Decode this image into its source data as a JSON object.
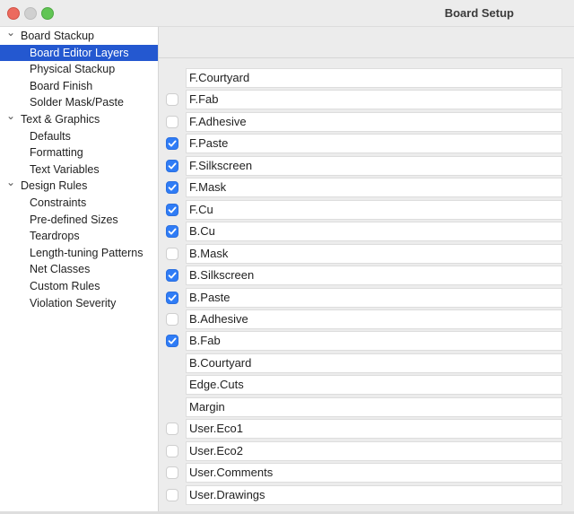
{
  "window": {
    "title": "Board Setup"
  },
  "sidebar": {
    "items": [
      {
        "label": "Board Stackup",
        "level": 0,
        "expanded": true,
        "selected": false
      },
      {
        "label": "Board Editor Layers",
        "level": 1,
        "selected": true
      },
      {
        "label": "Physical Stackup",
        "level": 1,
        "selected": false
      },
      {
        "label": "Board Finish",
        "level": 1,
        "selected": false
      },
      {
        "label": "Solder Mask/Paste",
        "level": 1,
        "selected": false
      },
      {
        "label": "Text & Graphics",
        "level": 0,
        "expanded": true,
        "selected": false
      },
      {
        "label": "Defaults",
        "level": 1,
        "selected": false
      },
      {
        "label": "Formatting",
        "level": 1,
        "selected": false
      },
      {
        "label": "Text Variables",
        "level": 1,
        "selected": false
      },
      {
        "label": "Design Rules",
        "level": 0,
        "expanded": true,
        "selected": false
      },
      {
        "label": "Constraints",
        "level": 1,
        "selected": false
      },
      {
        "label": "Pre-defined Sizes",
        "level": 1,
        "selected": false
      },
      {
        "label": "Teardrops",
        "level": 1,
        "selected": false
      },
      {
        "label": "Length-tuning Patterns",
        "level": 1,
        "selected": false
      },
      {
        "label": "Net Classes",
        "level": 1,
        "selected": false
      },
      {
        "label": "Custom Rules",
        "level": 1,
        "selected": false
      },
      {
        "label": "Violation Severity",
        "level": 1,
        "selected": false
      }
    ]
  },
  "layers": [
    {
      "name": "F.Courtyard",
      "checkbox": null
    },
    {
      "name": "F.Fab",
      "checkbox": false
    },
    {
      "name": "F.Adhesive",
      "checkbox": false
    },
    {
      "name": "F.Paste",
      "checkbox": true
    },
    {
      "name": "F.Silkscreen",
      "checkbox": true
    },
    {
      "name": "F.Mask",
      "checkbox": true
    },
    {
      "name": "F.Cu",
      "checkbox": true
    },
    {
      "name": "B.Cu",
      "checkbox": true
    },
    {
      "name": "B.Mask",
      "checkbox": false
    },
    {
      "name": "B.Silkscreen",
      "checkbox": true
    },
    {
      "name": "B.Paste",
      "checkbox": true
    },
    {
      "name": "B.Adhesive",
      "checkbox": false
    },
    {
      "name": "B.Fab",
      "checkbox": true
    },
    {
      "name": "B.Courtyard",
      "checkbox": null
    },
    {
      "name": "Edge.Cuts",
      "checkbox": null
    },
    {
      "name": "Margin",
      "checkbox": null
    },
    {
      "name": "User.Eco1",
      "checkbox": false
    },
    {
      "name": "User.Eco2",
      "checkbox": false
    },
    {
      "name": "User.Comments",
      "checkbox": false
    },
    {
      "name": "User.Drawings",
      "checkbox": false
    }
  ],
  "colors": {
    "selection": "#2458d0",
    "checkbox_checked": "#2f7cf6"
  }
}
